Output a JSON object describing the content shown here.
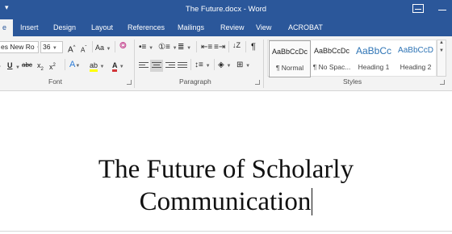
{
  "window": {
    "title": "The Future.docx - Word",
    "colors": {
      "titlebar": "#2b579a",
      "ribbon": "#f3f3f3",
      "accent_red": "#d13438",
      "highlight_yellow": "#ffff00"
    }
  },
  "tabs": [
    {
      "label": "e",
      "active": true
    },
    {
      "label": "Insert"
    },
    {
      "label": "Design"
    },
    {
      "label": "Layout"
    },
    {
      "label": "References"
    },
    {
      "label": "Mailings"
    },
    {
      "label": "Review"
    },
    {
      "label": "View"
    },
    {
      "label": "ACROBAT"
    }
  ],
  "font_group": {
    "label": "Font",
    "font_name": "es New Ro",
    "font_size": "36",
    "grow": "A",
    "shrink": "A",
    "change_case": "Aa",
    "underline": "U",
    "strike": "abc",
    "subscript": "x",
    "superscript": "x",
    "text_effects": "A",
    "highlight": "ab",
    "font_color": "A",
    "sub_mark": "2",
    "sup_mark": "2"
  },
  "paragraph_group": {
    "label": "Paragraph",
    "pilcrow": "¶"
  },
  "styles_group": {
    "label": "Styles",
    "styles": [
      {
        "sample": "AaBbCcDc",
        "name": "¶ Normal",
        "selected": true
      },
      {
        "sample": "AaBbCcDc",
        "name": "¶ No Spac..."
      },
      {
        "sample": "AaBbCc",
        "name": "Heading 1"
      },
      {
        "sample": "AaBbCcD",
        "name": "Heading 2"
      }
    ]
  },
  "document": {
    "title_line1": "The Future of Scholarly",
    "title_line2": "Communication"
  }
}
